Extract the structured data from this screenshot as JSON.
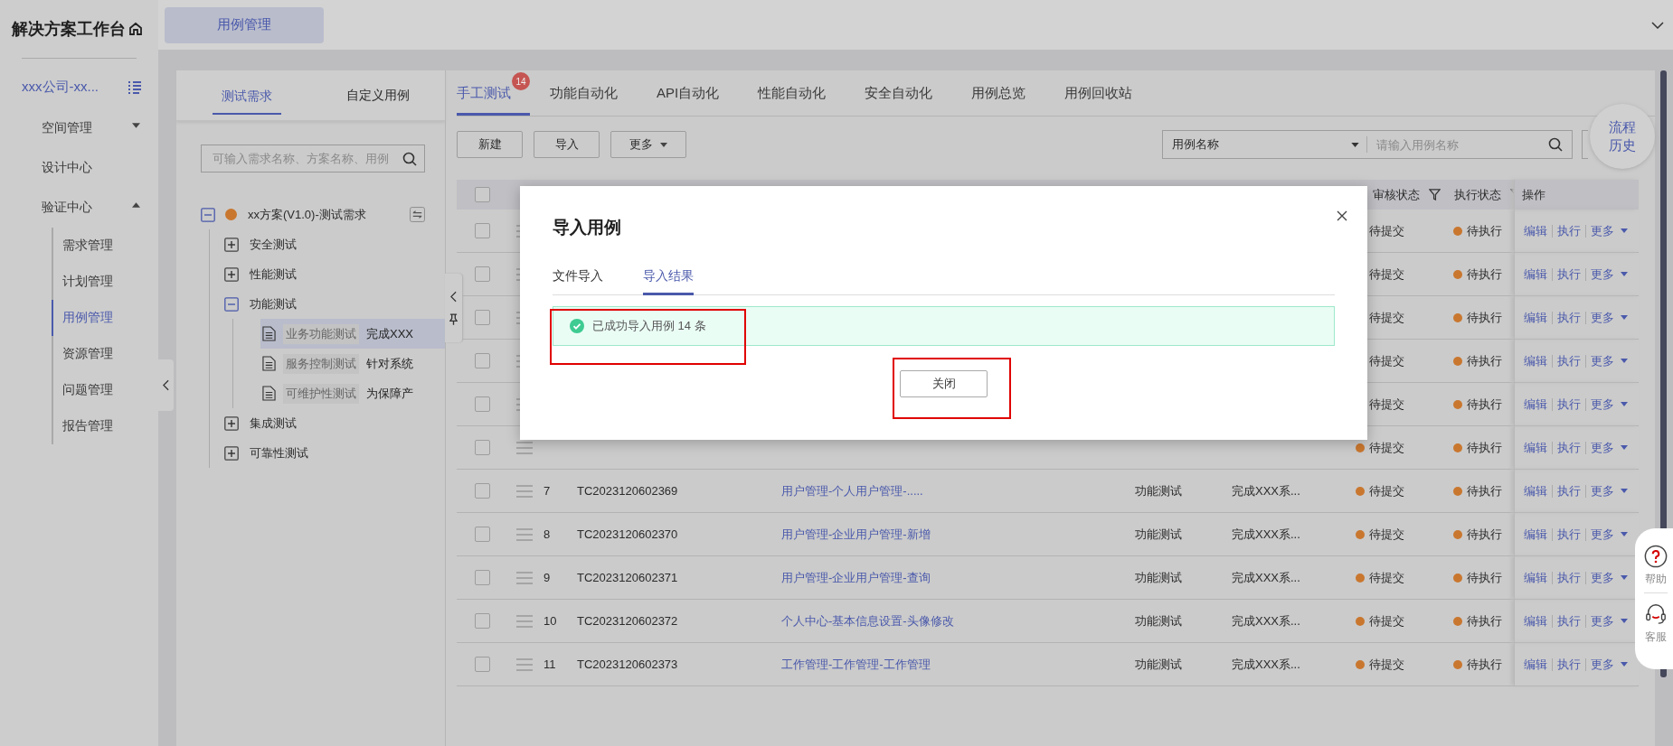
{
  "sidebar": {
    "title": "解决方案工作台",
    "org": "xxx公司-xx...",
    "nav": [
      {
        "label": "空间管理",
        "expanded": false
      },
      {
        "label": "设计中心"
      },
      {
        "label": "验证中心",
        "expanded": true,
        "children": [
          {
            "label": "需求管理",
            "selected": false
          },
          {
            "label": "计划管理",
            "selected": false
          },
          {
            "label": "用例管理",
            "selected": true
          },
          {
            "label": "资源管理",
            "selected": false
          },
          {
            "label": "问题管理",
            "selected": false
          },
          {
            "label": "报告管理",
            "selected": false
          }
        ]
      }
    ]
  },
  "page_tabs": [
    {
      "label": "用例管理",
      "selected": true
    }
  ],
  "tree_panel": {
    "tabs": [
      {
        "label": "测试需求",
        "selected": true
      },
      {
        "label": "自定义用例",
        "selected": false
      }
    ],
    "search": {
      "placeholder": "可输入需求名称、方案名称、用例"
    },
    "tree": {
      "label": "xx方案(V1.0)-测试需求",
      "expanded": true,
      "children": [
        {
          "label": "安全测试",
          "expanded": false
        },
        {
          "label": "性能测试",
          "expanded": false
        },
        {
          "label": "功能测试",
          "expanded": true,
          "children": [
            {
              "label": "业务功能测试",
              "description": "完成XXX",
              "selected": true
            },
            {
              "label": "服务控制测试",
              "description": "针对系统",
              "selected": false
            },
            {
              "label": "可维护性测试",
              "description": "为保障产",
              "selected": false
            }
          ]
        },
        {
          "label": "集成测试",
          "expanded": false
        },
        {
          "label": "可靠性测试",
          "expanded": false
        }
      ]
    }
  },
  "tabs": [
    {
      "label": "手工测试",
      "selected": true,
      "badge": "14"
    },
    {
      "label": "功能自动化",
      "selected": false
    },
    {
      "label": "API自动化",
      "selected": false
    },
    {
      "label": "性能自动化",
      "selected": false
    },
    {
      "label": "安全自动化",
      "selected": false
    },
    {
      "label": "用例总览",
      "selected": false
    },
    {
      "label": "用例回收站",
      "selected": false
    }
  ],
  "toolbar": {
    "buttons": [
      "新建",
      "导入"
    ],
    "more": "更多",
    "search": {
      "field": "用例名称",
      "placeholder": "请输入用例名称"
    }
  },
  "flow_history": "流程历史",
  "table": {
    "header_checked": false,
    "columns": {
      "review": "审核状态",
      "exec": "执行状态",
      "ops": "操作"
    },
    "rows": [
      {
        "checked": false,
        "review": "待提交",
        "exec": "待执行",
        "actions": [
          "编辑",
          "执行",
          "更多"
        ]
      },
      {
        "checked": false,
        "review": "待提交",
        "exec": "待执行",
        "actions": [
          "编辑",
          "执行",
          "更多"
        ]
      },
      {
        "checked": false,
        "review": "待提交",
        "exec": "待执行",
        "actions": [
          "编辑",
          "执行",
          "更多"
        ]
      },
      {
        "checked": false,
        "review": "待提交",
        "exec": "待执行",
        "actions": [
          "编辑",
          "执行",
          "更多"
        ]
      },
      {
        "checked": false,
        "review": "待提交",
        "exec": "待执行",
        "actions": [
          "编辑",
          "执行",
          "更多"
        ]
      },
      {
        "checked": false,
        "review": "待提交",
        "exec": "待执行",
        "actions": [
          "编辑",
          "执行",
          "更多"
        ]
      },
      {
        "checked": false,
        "no": "7",
        "code": "TC2023120602369",
        "name": "用户管理-个人用户管理-.....",
        "type": "功能测试",
        "desc": "完成XXX系...",
        "review": "待提交",
        "exec": "待执行",
        "actions": [
          "编辑",
          "执行",
          "更多"
        ]
      },
      {
        "checked": false,
        "no": "8",
        "code": "TC2023120602370",
        "name": "用户管理-企业用户管理-新增",
        "type": "功能测试",
        "desc": "完成XXX系...",
        "review": "待提交",
        "exec": "待执行",
        "actions": [
          "编辑",
          "执行",
          "更多"
        ]
      },
      {
        "checked": false,
        "no": "9",
        "code": "TC2023120602371",
        "name": "用户管理-企业用户管理-查询",
        "type": "功能测试",
        "desc": "完成XXX系...",
        "review": "待提交",
        "exec": "待执行",
        "actions": [
          "编辑",
          "执行",
          "更多"
        ]
      },
      {
        "checked": false,
        "no": "10",
        "code": "TC2023120602372",
        "name": "个人中心-基本信息设置-头像修改",
        "type": "功能测试",
        "desc": "完成XXX系...",
        "review": "待提交",
        "exec": "待执行",
        "actions": [
          "编辑",
          "执行",
          "更多"
        ]
      },
      {
        "checked": false,
        "no": "11",
        "code": "TC2023120602373",
        "name": "工作管理-工作管理-工作管理",
        "type": "功能测试",
        "desc": "完成XXX系...",
        "review": "待提交",
        "exec": "待执行",
        "actions": [
          "编辑",
          "执行",
          "更多"
        ]
      }
    ]
  },
  "help": [
    {
      "kind": "help",
      "label": "帮助"
    },
    {
      "kind": "service",
      "label": "客服"
    }
  ],
  "modal": {
    "title": "导入用例",
    "tabs": [
      {
        "label": "文件导入",
        "selected": false
      },
      {
        "label": "导入结果",
        "selected": true
      }
    ],
    "message": {
      "kind": "success",
      "text": "已成功导入用例 14 条"
    },
    "button": "关闭"
  }
}
